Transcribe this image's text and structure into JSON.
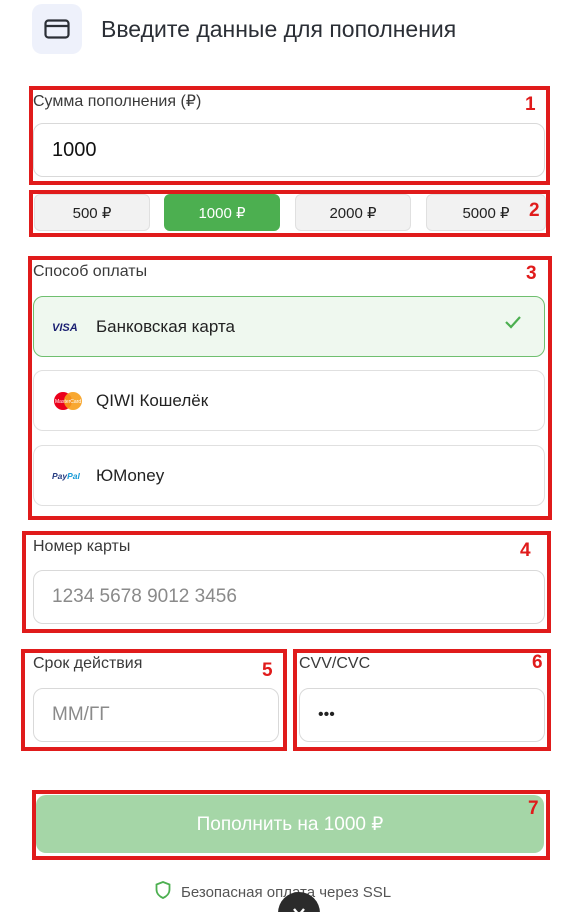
{
  "header": {
    "title": "Введите данные для пополнения",
    "icon": "credit-card-icon"
  },
  "amount": {
    "label": "Сумма пополнения (₽)",
    "value": "1000"
  },
  "presets": [
    {
      "label": "500 ₽",
      "active": false
    },
    {
      "label": "1000 ₽",
      "active": true
    },
    {
      "label": "2000 ₽",
      "active": false
    },
    {
      "label": "5000 ₽",
      "active": false
    }
  ],
  "payment_method": {
    "label": "Способ оплаты",
    "options": [
      {
        "label": "Банковская карта",
        "logo": "VISA",
        "selected": true
      },
      {
        "label": "QIWI Кошелёк",
        "logo": "MasterCard",
        "selected": false
      },
      {
        "label": "ЮMoney",
        "logo": "PayPal",
        "selected": false
      }
    ]
  },
  "card_number": {
    "label": "Номер карты",
    "placeholder": "1234 5678 9012 3456"
  },
  "expiry": {
    "label": "Срок действия",
    "placeholder": "ММ/ГГ"
  },
  "cvv": {
    "label": "CVV/CVC",
    "value": "•••"
  },
  "submit": {
    "label": "Пополнить на 1000 ₽"
  },
  "secure_note": {
    "text": "Безопасная оплата через SSL"
  },
  "annotations": [
    "1",
    "2",
    "3",
    "4",
    "5",
    "6",
    "7"
  ],
  "colors": {
    "accent": "#4caf50",
    "accent_light": "#a5d6a7",
    "annotation": "#e01b1b"
  }
}
